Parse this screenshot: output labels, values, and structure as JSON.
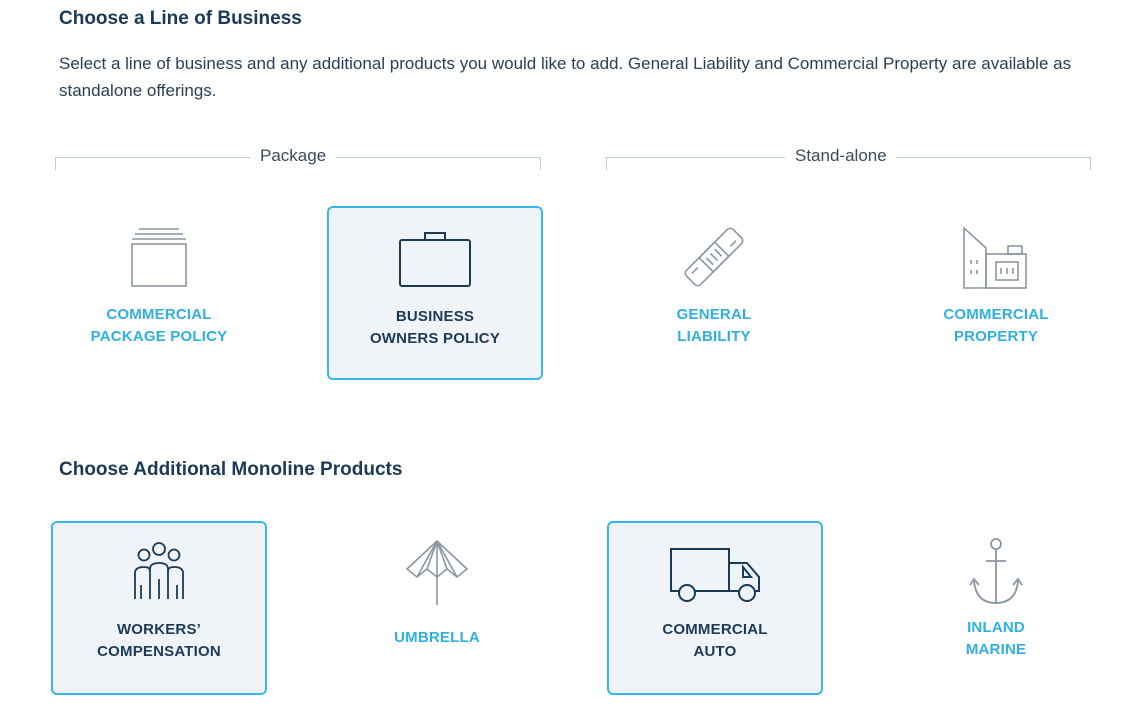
{
  "section1": {
    "title": "Choose a Line of Business",
    "description": "Select a line of business and any additional products you would like to add.  General Liability and Commercial Property are available as standalone offerings."
  },
  "groups": {
    "package": "Package",
    "standalone": "Stand-alone"
  },
  "lines_of_business": [
    {
      "line1": "COMMERCIAL",
      "line2": "PACKAGE POLICY",
      "icon": "stacked-folders-icon",
      "selected": false
    },
    {
      "line1": "BUSINESS",
      "line2": "OWNERS POLICY",
      "icon": "briefcase-icon",
      "selected": true
    },
    {
      "line1": "GENERAL",
      "line2": "LIABILITY",
      "icon": "bandage-icon",
      "selected": false
    },
    {
      "line1": "COMMERCIAL",
      "line2": "PROPERTY",
      "icon": "buildings-icon",
      "selected": false
    }
  ],
  "section2": {
    "title": "Choose Additional Monoline Products"
  },
  "monoline_products": [
    {
      "line1": "WORKERS’",
      "line2": "COMPENSATION",
      "icon": "people-group-icon",
      "selected": true
    },
    {
      "line1": "UMBRELLA",
      "line2": "",
      "icon": "umbrella-icon",
      "selected": false
    },
    {
      "line1": "COMMERCIAL",
      "line2": "AUTO",
      "icon": "truck-icon",
      "selected": true
    },
    {
      "line1": "INLAND",
      "line2": "MARINE",
      "icon": "anchor-icon",
      "selected": false
    }
  ],
  "colors": {
    "accent": "#38b8e6",
    "label_unselected": "#2fb0e2",
    "label_selected": "#1b3a57",
    "selected_bg": "#f0f4f8",
    "icon_unselected": "#8a96a3",
    "icon_selected": "#1b3a57"
  }
}
